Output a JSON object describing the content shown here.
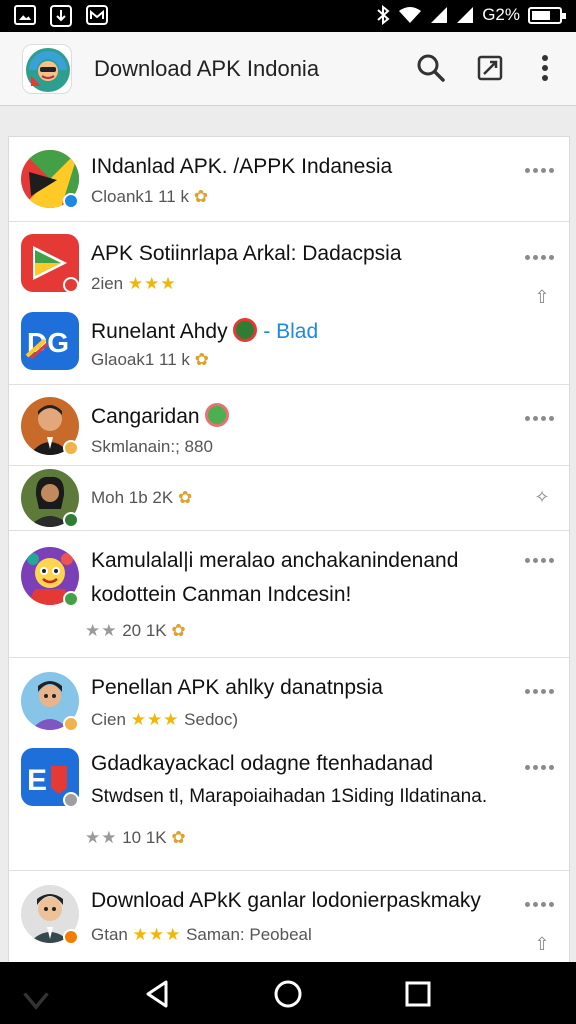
{
  "status_bar": {
    "battery_text": "G2%",
    "icons": [
      "image-icon",
      "download-icon",
      "app-icon",
      "bluetooth-icon",
      "wifi-icon",
      "signal-icon",
      "signal-icon",
      "battery-icon"
    ]
  },
  "app_bar": {
    "title": "Download APK Indonia",
    "actions": [
      "search-icon",
      "edit-icon",
      "overflow-menu-icon"
    ]
  },
  "items": [
    {
      "title": "INdanlad APK. /APPK Indanesia",
      "sub": "Cloank1 11 k",
      "accent": "#f0b24b"
    },
    {
      "title": "APK Sotiinrlapa Arkal: Dadacpsia",
      "sub": "2ien",
      "stars": "★★★",
      "accent": "#e53935"
    },
    {
      "title": "Runelant Ahdy",
      "title_suffix": "- Blad",
      "sub": "Glaoak1 11 k",
      "accent": "#1e88e5"
    },
    {
      "title": "Cangaridan",
      "sub": "Skmlanain:; 880",
      "accent": "#f0b24b"
    },
    {
      "sub": "Moh 1b 2K",
      "accent": "#2e7d32"
    },
    {
      "title": "Kamulalal|i meralao anchakanindenand",
      "title2": "kodottein Canman Indcesin!",
      "rating": "20 1K",
      "gstars": "★★",
      "accent": "#43a047"
    },
    {
      "title": "Penellan APK ahlky danatnpsia",
      "sub_prefix": "Cien",
      "stars": "★★★",
      "sub_suffix": "Sedoc)",
      "accent": "#f0b24b"
    },
    {
      "title": "Gdadkayackacl odagne ftenhadanad",
      "title2": "Stwdsen tl, Marapoiaihadan 1Siding Ildatinana.",
      "rating": "10 1K",
      "gstars": "★★",
      "accent": "#9e9e9e"
    },
    {
      "title": "Download APkK ganlar lodonierpaskmaky",
      "sub_prefix": "Gtan",
      "stars": "★★★",
      "sub_suffix": "Saman: Peobeal",
      "accent": "#f57c00"
    }
  ],
  "nav_bar": {
    "buttons": [
      "back-icon",
      "home-icon",
      "recents-icon"
    ]
  }
}
